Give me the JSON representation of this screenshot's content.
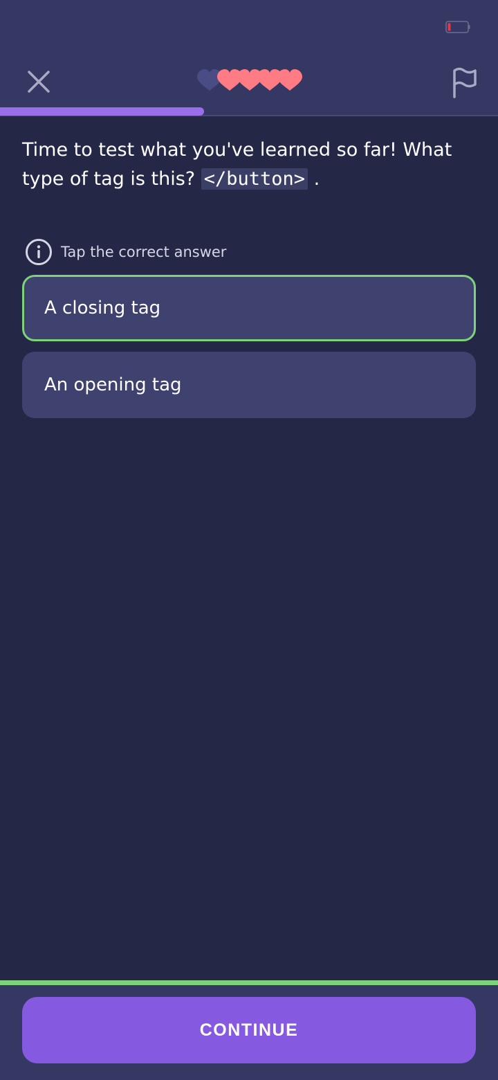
{
  "statusbar": {
    "battery_icon": "battery-low-icon"
  },
  "header": {
    "close_icon": "close-icon",
    "flag_icon": "flag-icon",
    "lives": {
      "total": 5,
      "remaining": 4,
      "colors": {
        "full": "#ff7c84",
        "empty": "#4a4c86"
      }
    },
    "progress": {
      "fraction": 0.41,
      "color": "#9a6ee8"
    }
  },
  "question": {
    "text_before": "Time to test what you've learned so far! What type of tag is this? ",
    "code": "</button>",
    "text_after": " ."
  },
  "hint": {
    "icon": "info-icon",
    "text": "Tap the correct answer"
  },
  "options": [
    {
      "label": "A closing tag",
      "selected": true
    },
    {
      "label": "An opening tag",
      "selected": false
    }
  ],
  "footer": {
    "continue_label": "CONTINUE"
  },
  "colors": {
    "background": "#242846",
    "header": "#363864",
    "option": "#3f416f",
    "selected_border": "#7ed27b",
    "button": "#8559e0"
  }
}
